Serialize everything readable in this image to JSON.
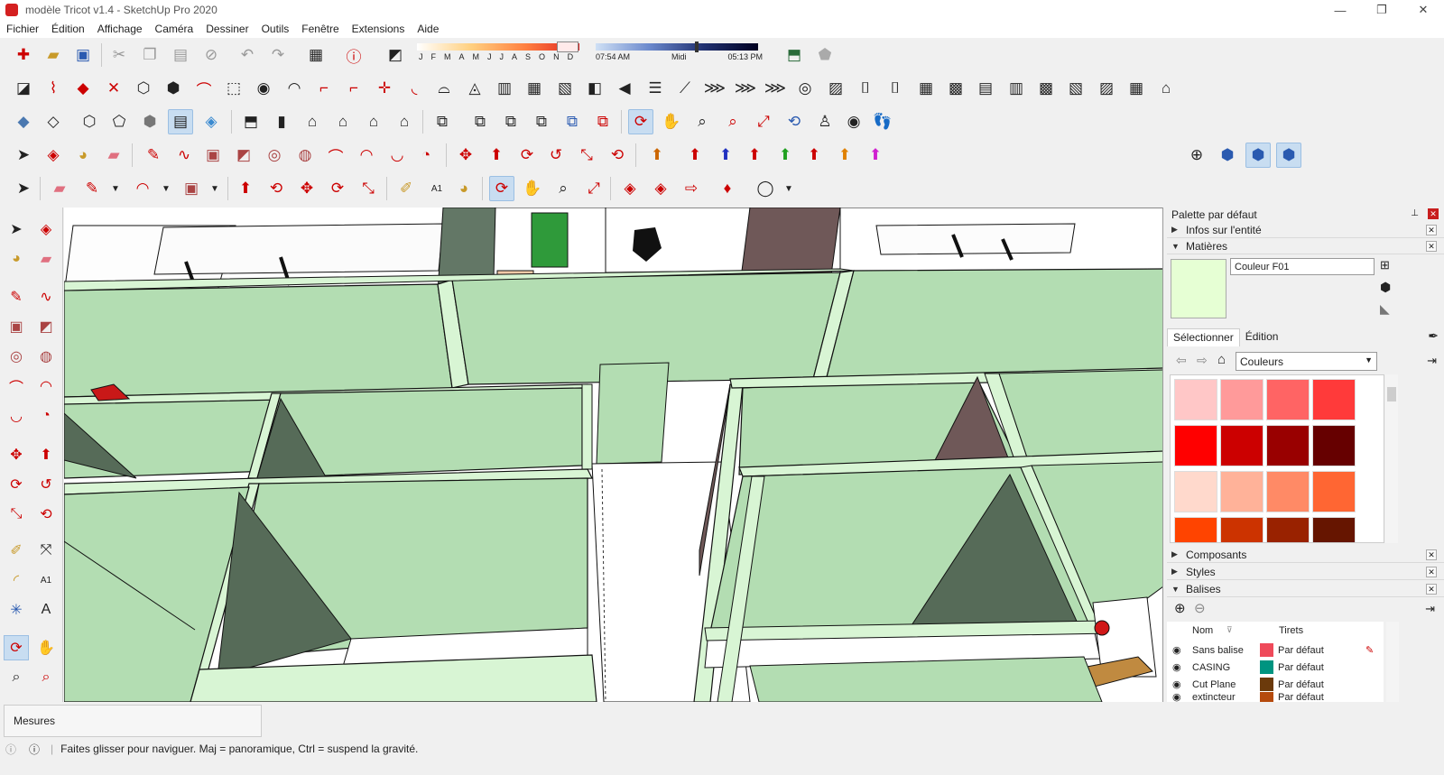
{
  "window": {
    "title": "modèle Tricot v1.4 - SketchUp Pro 2020",
    "minimize": "—",
    "restore": "❐",
    "close": "✕"
  },
  "menu": [
    "Fichier",
    "Édition",
    "Affichage",
    "Caméra",
    "Dessiner",
    "Outils",
    "Fenêtre",
    "Extensions",
    "Aide"
  ],
  "shadows": {
    "months": [
      "J",
      "F",
      "M",
      "A",
      "M",
      "J",
      "J",
      "A",
      "S",
      "O",
      "N",
      "D"
    ],
    "time_start": "07:54 AM",
    "time_mid": "Midi",
    "time_end": "05:13 PM"
  },
  "panel": {
    "title": "Palette par défaut",
    "sections": {
      "entity_info": "Infos sur l'entité",
      "materials": "Matières",
      "components": "Composants",
      "styles": "Styles",
      "tags": "Balises"
    },
    "material_name": "Couleur F01",
    "material_color": "#e6ffd4",
    "tabs": {
      "select": "Sélectionner",
      "edit": "Édition"
    },
    "library": "Couleurs",
    "swatches": [
      "#ffc7c7",
      "#ff9a9a",
      "#ff6464",
      "#ff3a3a",
      "#ff0000",
      "#cc0000",
      "#990000",
      "#660000",
      "#ffd9cc",
      "#ffb299",
      "#ff8a66",
      "#ff6633",
      "#ff4400",
      "#cc3300",
      "#992200",
      "#661500"
    ],
    "tags_header": {
      "name": "Nom",
      "dash": "Tirets"
    },
    "tags": [
      {
        "name": "Sans balise",
        "color": "#ef4a5a",
        "dash": "Par défaut"
      },
      {
        "name": "CASING",
        "color": "#009480",
        "dash": "Par défaut"
      },
      {
        "name": "Cut Plane",
        "color": "#6b3a0b",
        "dash": "Par défaut"
      },
      {
        "name": "extincteur",
        "color": "#b54a0c",
        "dash": "Par défaut"
      }
    ]
  },
  "measurements_label": "Mesures",
  "status_text": "Faites glisser pour naviguer. Maj = panoramique, Ctrl =  suspend la gravité.",
  "colors": {
    "accent": "#c8ddf1",
    "wall_green": "#b3ddb2",
    "wall_edge": "#d8f5d4",
    "shadow_dark": "#566b58",
    "brown": "#6f5858"
  }
}
